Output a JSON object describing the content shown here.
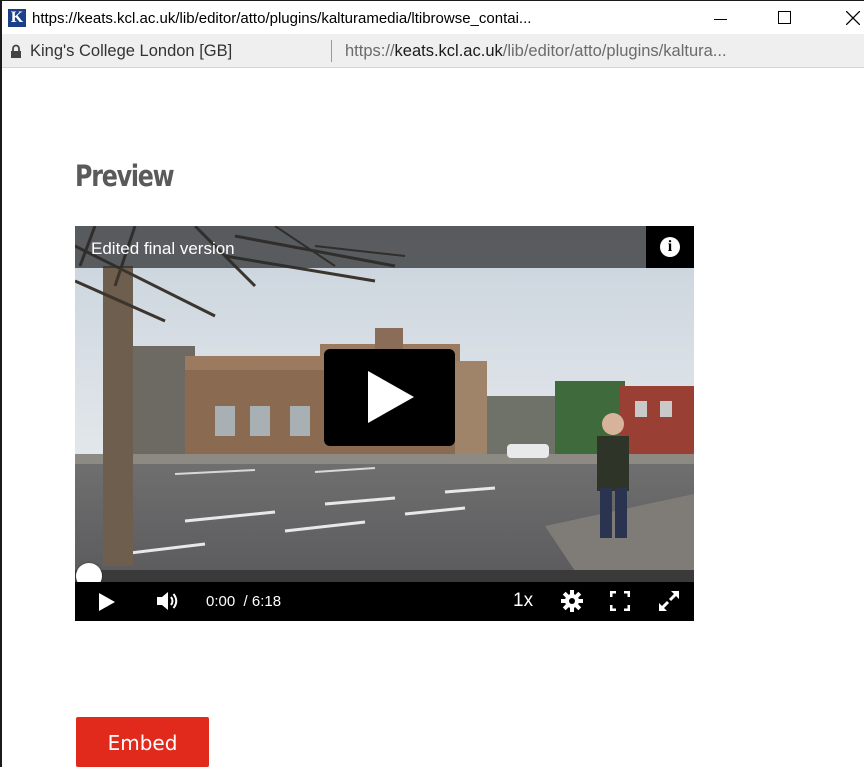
{
  "window": {
    "title": "https://keats.kcl.ac.uk/lib/editor/atto/plugins/kalturamedia/ltibrowse_contai...",
    "app_icon_letter": "K"
  },
  "addressbar": {
    "org": "King's College London [GB]",
    "url_scheme": "https://",
    "url_host": "keats.kcl.ac.uk",
    "url_path": "/lib/editor/atto/plugins/kaltura..."
  },
  "page": {
    "heading": "Preview"
  },
  "player": {
    "video_title": "Edited final version",
    "info_glyph": "i",
    "current_time": "0:00",
    "duration": "/ 6:18",
    "speed": "1x",
    "progress": 0,
    "icons": [
      "info-icon",
      "play-icon",
      "volume-icon",
      "gear-icon",
      "fullscreen-icon",
      "expand-icon"
    ]
  },
  "actions": {
    "embed_label": "Embed",
    "embed_color": "#e22a1c"
  }
}
